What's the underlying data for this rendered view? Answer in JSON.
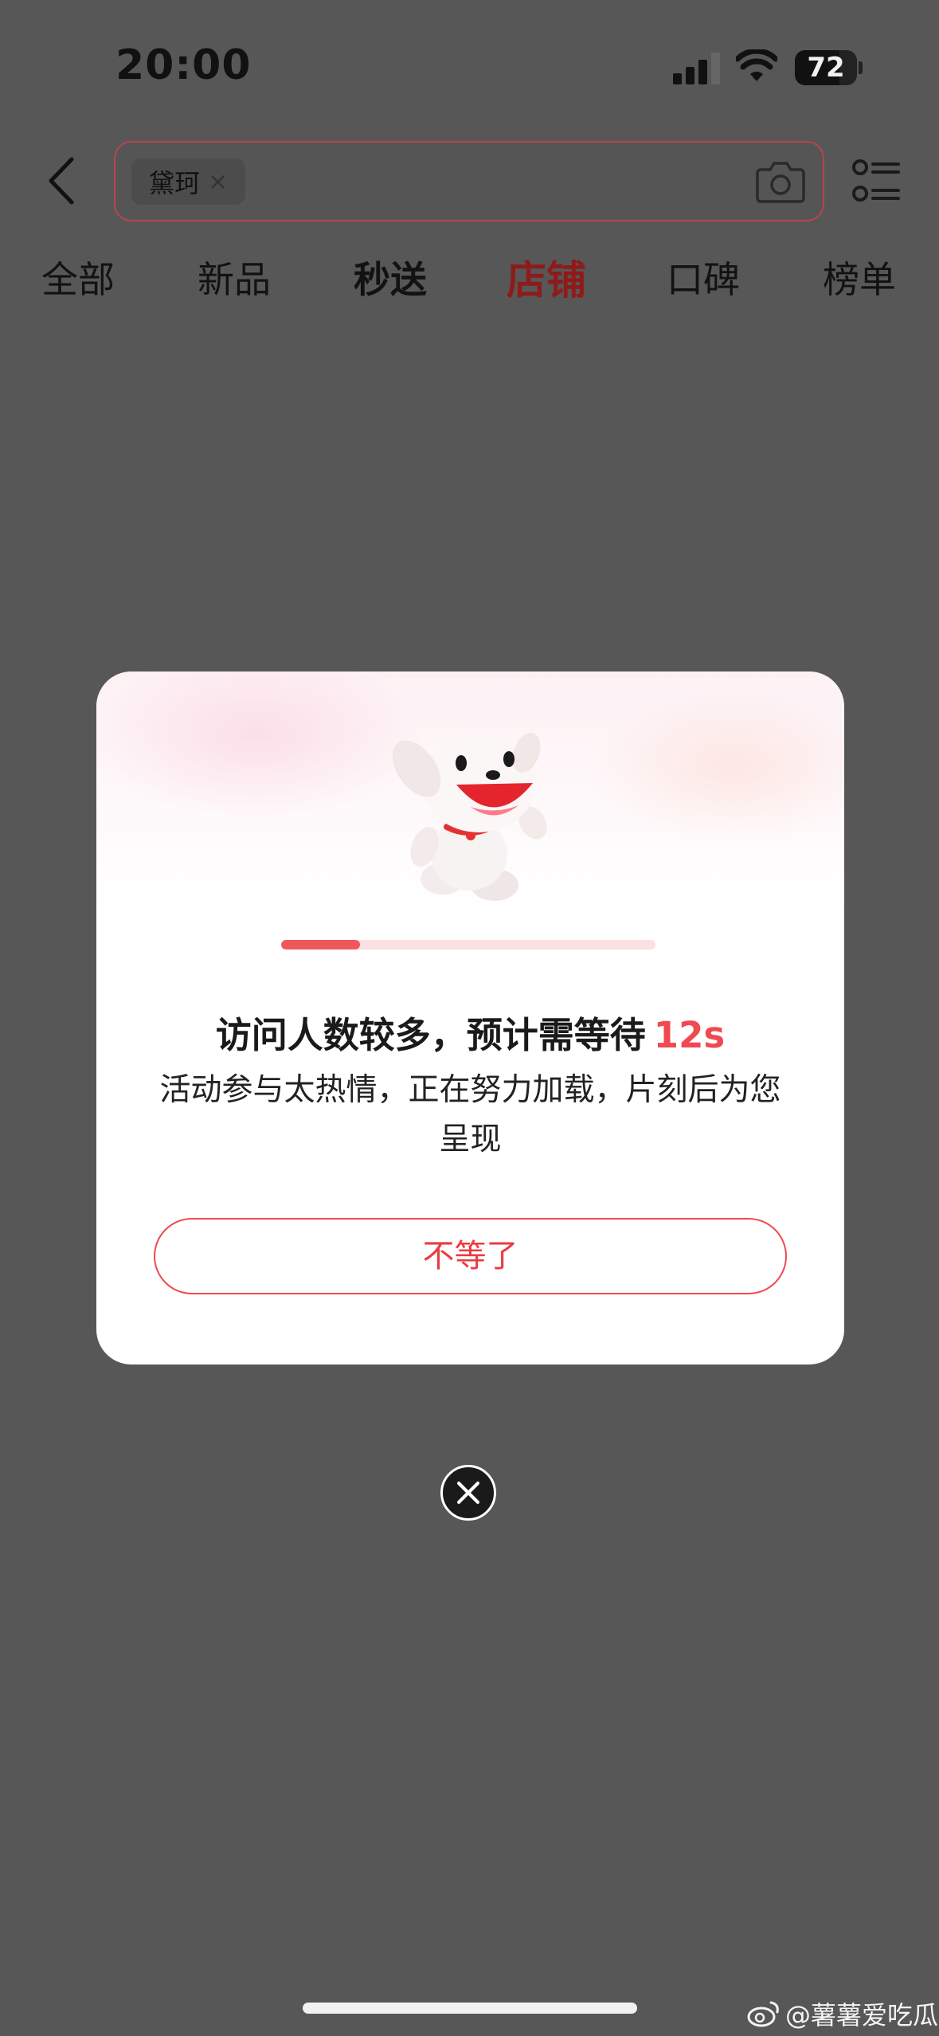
{
  "status_bar": {
    "time": "20:00",
    "battery": "72",
    "battery_level": 0.72
  },
  "search": {
    "chip_text": "黛珂",
    "chip_remove": "×"
  },
  "tabs": [
    {
      "label": "全部"
    },
    {
      "label": "新品"
    },
    {
      "label": "秒送"
    },
    {
      "label": "店铺"
    },
    {
      "label": "口碑"
    },
    {
      "label": "榜单"
    }
  ],
  "active_tab_index": 3,
  "modal": {
    "title": "访问人数较多，预计需等待",
    "wait_time": "12s",
    "description": "活动参与太热情，正在努力加载，片刻后为您呈现",
    "progress": 0.21,
    "button_label": "不等了"
  },
  "watermark": {
    "text": "@薯薯爱吃瓜"
  },
  "colors": {
    "accent": "#ef4a4f",
    "active_tab": "#8f1a1a",
    "overlay": "#575757"
  }
}
